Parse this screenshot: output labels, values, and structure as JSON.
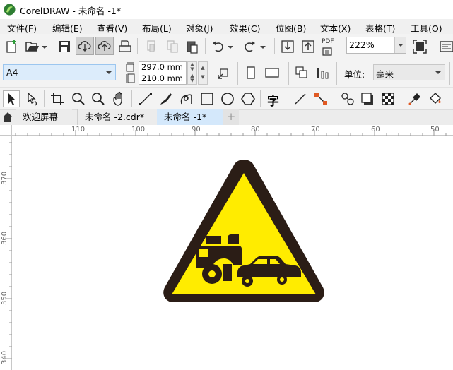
{
  "window": {
    "title": "CorelDRAW - 未命名 -1*"
  },
  "menu": [
    "文件(F)",
    "编辑(E)",
    "查看(V)",
    "布局(L)",
    "对象(J)",
    "效果(C)",
    "位图(B)",
    "文本(X)",
    "表格(T)",
    "工具(O)"
  ],
  "toolbar": {
    "zoom": "222%",
    "pdf_label": "PDF"
  },
  "property_bar": {
    "page_size": "A4",
    "width": "297.0 mm",
    "height": "210.0 mm",
    "unit_label": "单位:",
    "unit_value": "毫米"
  },
  "toolbox": {
    "text_tool_glyph": "字"
  },
  "tabs": [
    "欢迎屏幕",
    "未命名 -2.cdr*",
    "未命名 -1*"
  ],
  "add_tab": "+",
  "ruler": {
    "top": [
      "110",
      "100",
      "90",
      "80",
      "70",
      "60",
      "50"
    ],
    "left": [
      "370",
      "360",
      "350",
      "340"
    ]
  },
  "colors": {
    "accent": "#d4e8fb",
    "sign_yellow": "#ffec00",
    "sign_border": "#2b1d16"
  }
}
